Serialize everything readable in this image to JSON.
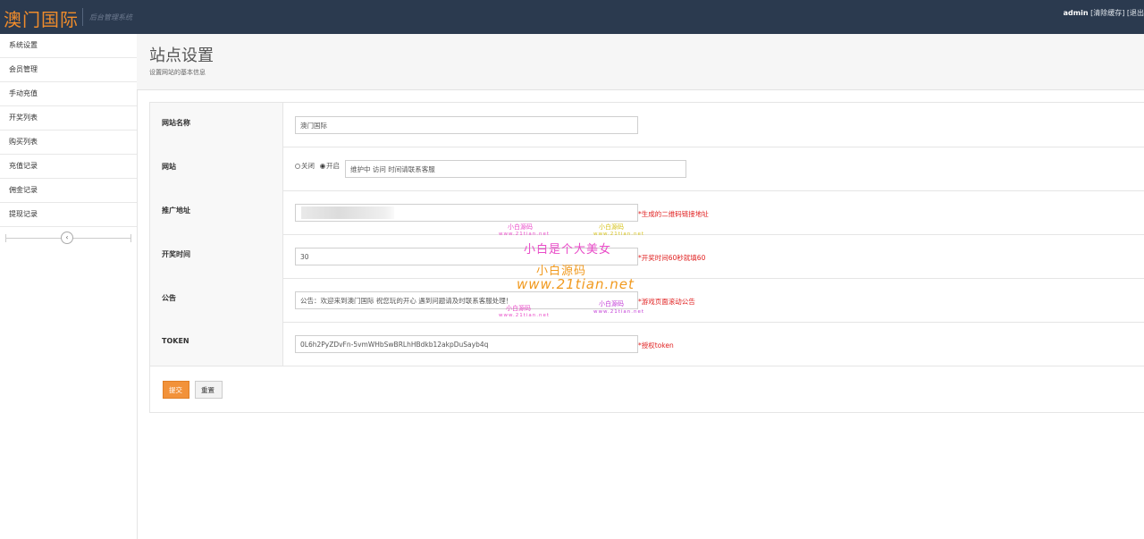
{
  "header": {
    "brand": "澳门国际",
    "subtitle": "后台管理系统",
    "username": "admin",
    "clear_cache": "[清除缓存]",
    "logout": "[退出"
  },
  "sidebar": {
    "items": [
      {
        "label": "系统设置"
      },
      {
        "label": "会员管理"
      },
      {
        "label": "手动充值"
      },
      {
        "label": "开奖列表"
      },
      {
        "label": "购买列表"
      },
      {
        "label": "充值记录"
      },
      {
        "label": "佣金记录"
      },
      {
        "label": "提现记录"
      }
    ],
    "collapse_icon": "chevron-left-icon",
    "collapse_glyph": "‹"
  },
  "page": {
    "title": "站点设置",
    "subtitle": "设置网站的基本信息"
  },
  "form": {
    "site_name": {
      "label": "网站名称",
      "value": "澳门国际"
    },
    "site_status": {
      "label": "网站",
      "option_off": "关闭",
      "option_on": "开启",
      "selected": "开启",
      "message": "维护中 访问 时间请联系客服"
    },
    "promo_url": {
      "label": "推广地址",
      "hint": "*生成的二维码链接地址"
    },
    "draw_time": {
      "label": "开奖时间",
      "value": "30",
      "hint": "*开奖时间60秒就填60"
    },
    "notice": {
      "label": "公告",
      "value": "公告：欢迎来到澳门国际 祝您玩的开心 遇到问题请及时联系客服处理！",
      "hint": "*游戏页面滚动公告"
    },
    "token": {
      "label": "TOKEN",
      "value": "0L6h2PyZDvFn-5vmWHbSwBRLhHBdkb12akpDuSayb4q",
      "hint": "*授权token"
    },
    "submit_label": "提交",
    "reset_label": "重置"
  },
  "watermark": {
    "small_1": "小白源码",
    "small_url": "www.21tian.net",
    "small_2": "小白源码",
    "big_1": "小白是个大美女",
    "big_2": "小白源码",
    "url": "www.21tian.net"
  },
  "colors": {
    "header_bg": "#2b3a4f",
    "brand": "#f08c2b",
    "hint": "#e02020",
    "submit": "#f2923a"
  }
}
